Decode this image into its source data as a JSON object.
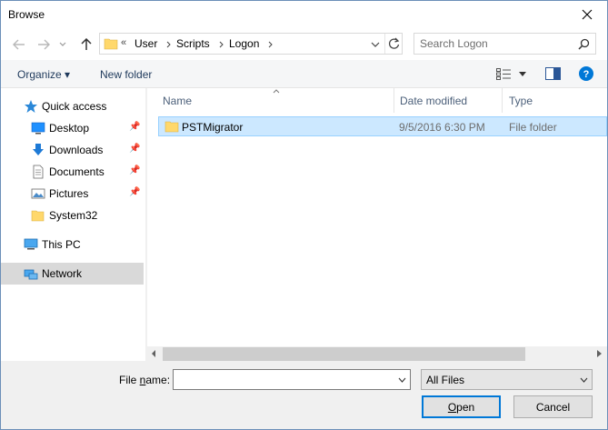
{
  "window": {
    "title": "Browse"
  },
  "nav": {
    "back_label": "Back",
    "forward_label": "Forward",
    "up_label": "Up",
    "breadcrumb": {
      "overflow": "«",
      "parts": [
        "User",
        "Scripts",
        "Logon"
      ]
    },
    "search_placeholder": "Search Logon"
  },
  "toolbar": {
    "organize_label": "Organize ▾",
    "new_folder_label": "New folder"
  },
  "sidebar": {
    "quick_access": "Quick access",
    "items": [
      {
        "label": "Desktop",
        "pinned": true,
        "icon": "desktop-icon"
      },
      {
        "label": "Downloads",
        "pinned": true,
        "icon": "downloads-icon"
      },
      {
        "label": "Documents",
        "pinned": true,
        "icon": "documents-icon"
      },
      {
        "label": "Pictures",
        "pinned": true,
        "icon": "pictures-icon"
      },
      {
        "label": "System32",
        "pinned": false,
        "icon": "folder-icon"
      }
    ],
    "this_pc": "This PC",
    "network": "Network",
    "selected": "Network"
  },
  "columns": {
    "name": "Name",
    "date": "Date modified",
    "type": "Type"
  },
  "files": [
    {
      "name": "PSTMigrator",
      "date": "9/5/2016 6:30 PM",
      "type": "File folder",
      "selected": true
    }
  ],
  "footer": {
    "file_name_label_pre": "File ",
    "file_name_label_u": "n",
    "file_name_label_post": "ame:",
    "file_name_value": "",
    "filter_value": "All Files",
    "open_pre": "",
    "open_u": "O",
    "open_post": "pen",
    "cancel_label": "Cancel"
  },
  "colors": {
    "selection": "#cce8ff",
    "selection_border": "#99d1ff",
    "accent": "#0078d7",
    "folder": "#ffd86b"
  }
}
